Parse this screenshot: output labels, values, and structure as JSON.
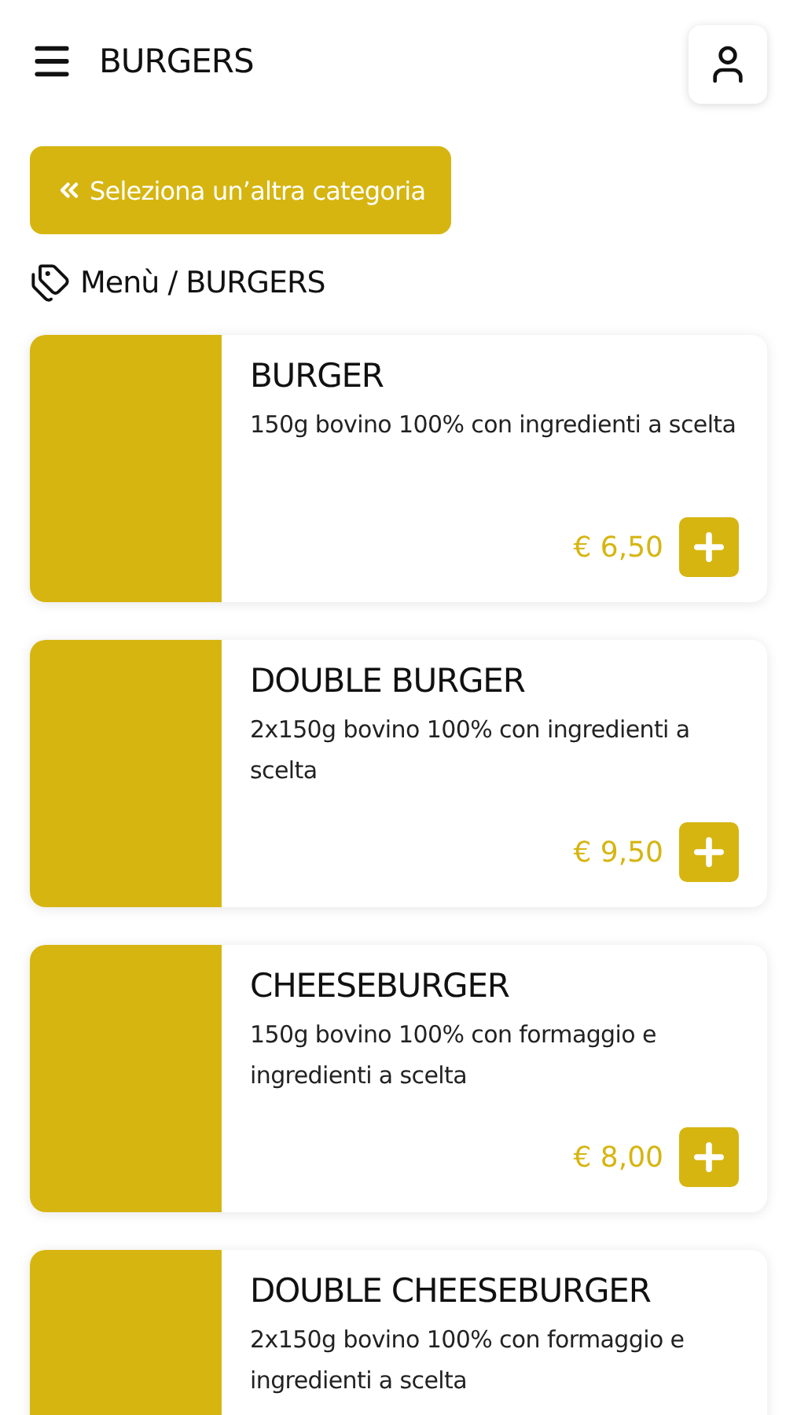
{
  "header": {
    "title": "BURGERS"
  },
  "back_button": {
    "label": "Seleziona un’altra categoria"
  },
  "breadcrumb": {
    "text": "Menù / BURGERS"
  },
  "products": [
    {
      "name": "BURGER",
      "description": "150g bovino 100% con ingredienti a scelta",
      "price": "€ 6,50"
    },
    {
      "name": "DOUBLE BURGER",
      "description": "2x150g bovino 100% con ingredienti a scelta",
      "price": "€ 9,50"
    },
    {
      "name": "CHEESEBURGER",
      "description": "150g bovino 100% con formaggio e ingredienti a scelta",
      "price": "€ 8,00"
    },
    {
      "name": "DOUBLE CHEESEBURGER",
      "description": "2x150g bovino 100% con formaggio e ingredienti a scelta"
    }
  ]
}
